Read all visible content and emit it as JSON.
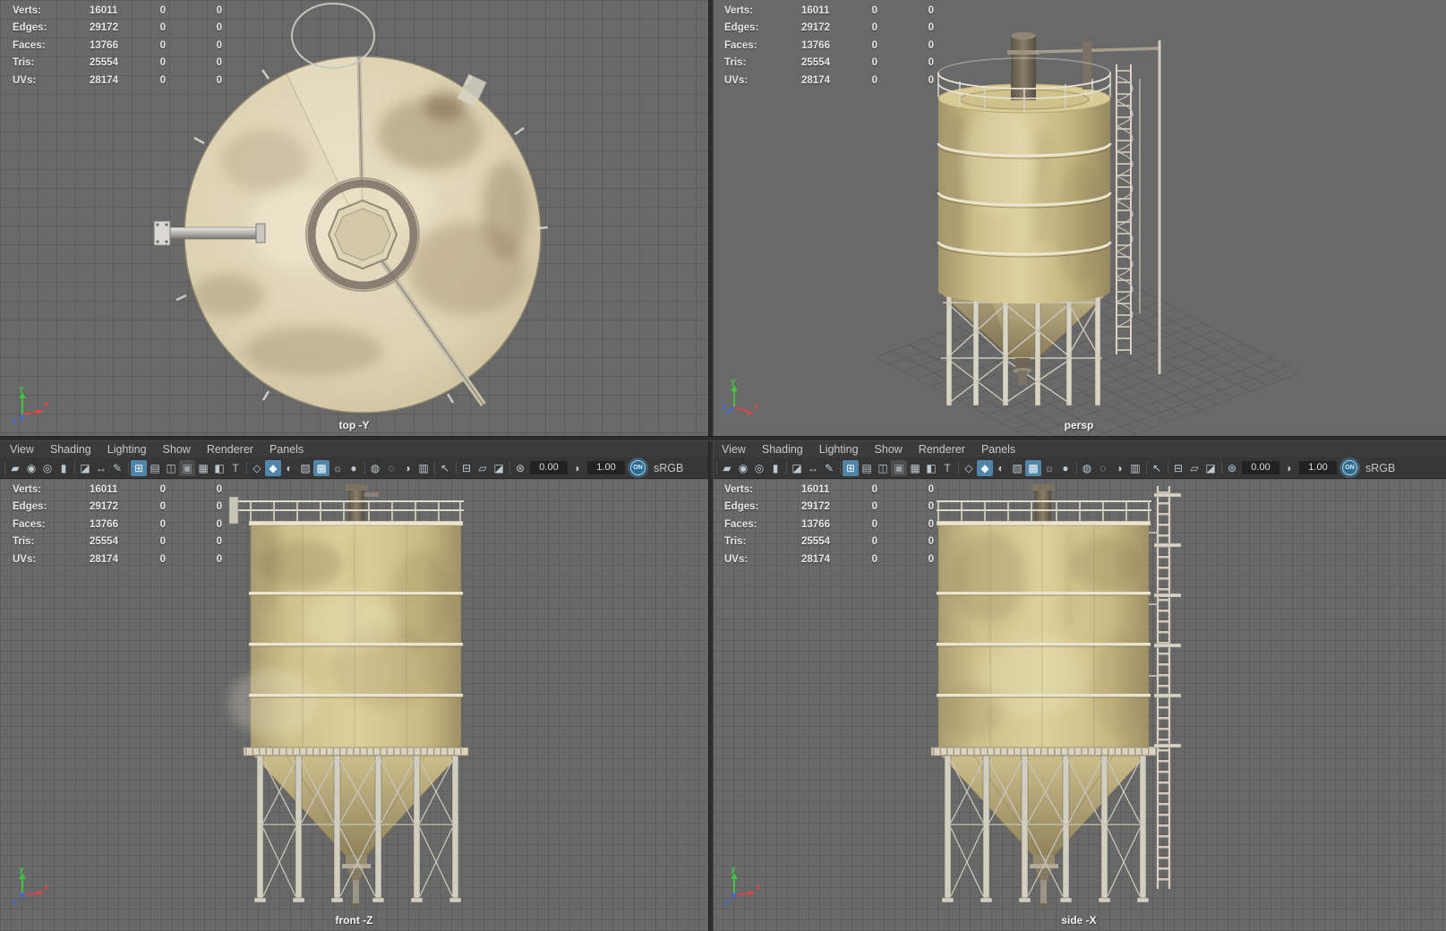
{
  "hud": {
    "rows": [
      {
        "label": "Verts:",
        "count": "16011",
        "c2": "0",
        "c3": "0"
      },
      {
        "label": "Edges:",
        "count": "29172",
        "c2": "0",
        "c3": "0"
      },
      {
        "label": "Faces:",
        "count": "13766",
        "c2": "0",
        "c3": "0"
      },
      {
        "label": "Tris:",
        "count": "25554",
        "c2": "0",
        "c3": "0"
      },
      {
        "label": "UVs:",
        "count": "28174",
        "c2": "0",
        "c3": "0"
      }
    ]
  },
  "panel_menu": {
    "items": [
      "View",
      "Shading",
      "Lighting",
      "Show",
      "Renderer",
      "Panels"
    ]
  },
  "toolbar": {
    "items": [
      {
        "type": "sep"
      },
      {
        "name": "select-camera-icon",
        "glyph": "▰"
      },
      {
        "name": "lock-camera-icon",
        "glyph": "◉"
      },
      {
        "name": "camera-attributes-icon",
        "glyph": "◎"
      },
      {
        "name": "bookmark-icon",
        "glyph": "▮"
      },
      {
        "type": "sep"
      },
      {
        "name": "image-plane-icon",
        "glyph": "◪"
      },
      {
        "name": "2d-pan-zoom-icon",
        "glyph": "↔"
      },
      {
        "name": "grease-pencil-icon",
        "glyph": "✎"
      },
      {
        "type": "sep"
      },
      {
        "name": "grid-icon",
        "glyph": "⊞",
        "active": true
      },
      {
        "name": "film-gate-icon",
        "glyph": "▤"
      },
      {
        "name": "resolution-gate-icon",
        "glyph": "◫"
      },
      {
        "name": "gate-mask-icon",
        "glyph": "▣",
        "dim": true
      },
      {
        "name": "field-chart-icon",
        "glyph": "▦"
      },
      {
        "name": "safe-action-icon",
        "glyph": "◧"
      },
      {
        "name": "safe-title-icon",
        "glyph": "T"
      },
      {
        "type": "sep"
      },
      {
        "name": "wireframe-icon",
        "glyph": "◇"
      },
      {
        "name": "smooth-shade-icon",
        "glyph": "◆",
        "active": true
      },
      {
        "name": "default-material-icon",
        "glyph": "◐"
      },
      {
        "name": "textured-icon",
        "glyph": "▧"
      },
      {
        "name": "material-override-icon",
        "glyph": "▩",
        "active": true
      },
      {
        "name": "lights-icon",
        "glyph": "☼"
      },
      {
        "name": "shadows-icon",
        "glyph": "●"
      },
      {
        "type": "sep"
      },
      {
        "name": "occlusion-icon",
        "glyph": "◍"
      },
      {
        "name": "motion-blur-icon",
        "glyph": "◌"
      },
      {
        "name": "depth-of-field-icon",
        "glyph": "◑"
      },
      {
        "name": "render-region-icon",
        "glyph": "▥"
      },
      {
        "type": "sep"
      },
      {
        "name": "isolate-select-icon",
        "glyph": "↖"
      },
      {
        "type": "sep"
      },
      {
        "name": "xray-icon",
        "glyph": "⊟"
      },
      {
        "name": "xray-active-icon",
        "glyph": "▱"
      },
      {
        "name": "plane-split-icon",
        "glyph": "◪"
      },
      {
        "type": "sep"
      },
      {
        "name": "exposure-icon",
        "glyph": "⊛"
      },
      {
        "type": "field",
        "name": "exposure-field",
        "value": "0.00"
      },
      {
        "name": "contrast-icon",
        "glyph": "◗"
      },
      {
        "type": "field",
        "name": "gamma-field",
        "value": "1.00"
      },
      {
        "type": "toggle",
        "name": "colorspace-on-toggle",
        "label": "ON"
      },
      {
        "type": "label",
        "name": "colorspace-label",
        "text": "sRGB"
      }
    ]
  },
  "viewports": {
    "top": {
      "label": "top -Y"
    },
    "persp": {
      "label": "persp"
    },
    "front": {
      "label": "front -Z"
    },
    "side": {
      "label": "side -X"
    }
  },
  "axes": {
    "x": "x",
    "y": "y",
    "z": "z"
  },
  "colors": {
    "viewport_bg": "#696969",
    "grid_line": "#5e5e5e",
    "panel_bg": "#3b3b3b",
    "accent_blue": "#5185a8",
    "toggle_blue": "#9fd8f0",
    "silo_cream": "#d9cc96",
    "axis_x": "#cf4a4a",
    "axis_y": "#44c044",
    "axis_z": "#4468d8",
    "hud_text": "#e6e6e6"
  }
}
